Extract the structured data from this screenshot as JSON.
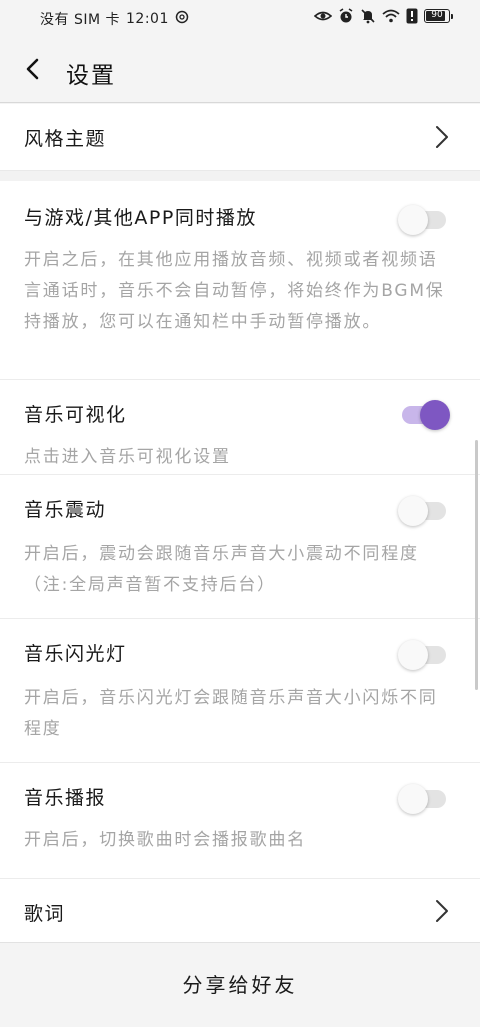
{
  "status_bar": {
    "carrier": "没有 SIM 卡",
    "time": "12:01",
    "battery": "90",
    "icons": [
      "eye-icon",
      "alarm-icon",
      "mute-icon",
      "wifi-icon",
      "alert-icon",
      "battery-icon"
    ]
  },
  "header": {
    "title": "设置",
    "back_icon": "back-arrow-icon"
  },
  "theme_row": {
    "label": "风格主题"
  },
  "settings": [
    {
      "title": "与游戏/其他APP同时播放",
      "description": "开启之后，在其他应用播放音频、视频或者视频语言通话时，音乐不会自动暂停，将始终作为BGM保持播放，您可以在通知栏中手动暂停播放。",
      "enabled": false
    },
    {
      "title": "音乐可视化",
      "description": "点击进入音乐可视化设置",
      "enabled": true
    },
    {
      "title": "音乐震动",
      "description": "开启后，震动会跟随音乐声音大小震动不同程度（注:全局声音暂不支持后台）",
      "enabled": false
    },
    {
      "title": "音乐闪光灯",
      "description": "开启后，音乐闪光灯会跟随音乐声音大小闪烁不同程度",
      "enabled": false
    },
    {
      "title": "音乐播报",
      "description": "开启后，切换歌曲时会播报歌曲名",
      "enabled": false
    }
  ],
  "lyrics_row": {
    "label": "歌词"
  },
  "share": {
    "label": "分享给好友"
  },
  "colors": {
    "accent": "#7e57c2",
    "accent_track": "#c8b6ea",
    "description_text": "#a5a5a5",
    "background": "#f4f4f4"
  }
}
